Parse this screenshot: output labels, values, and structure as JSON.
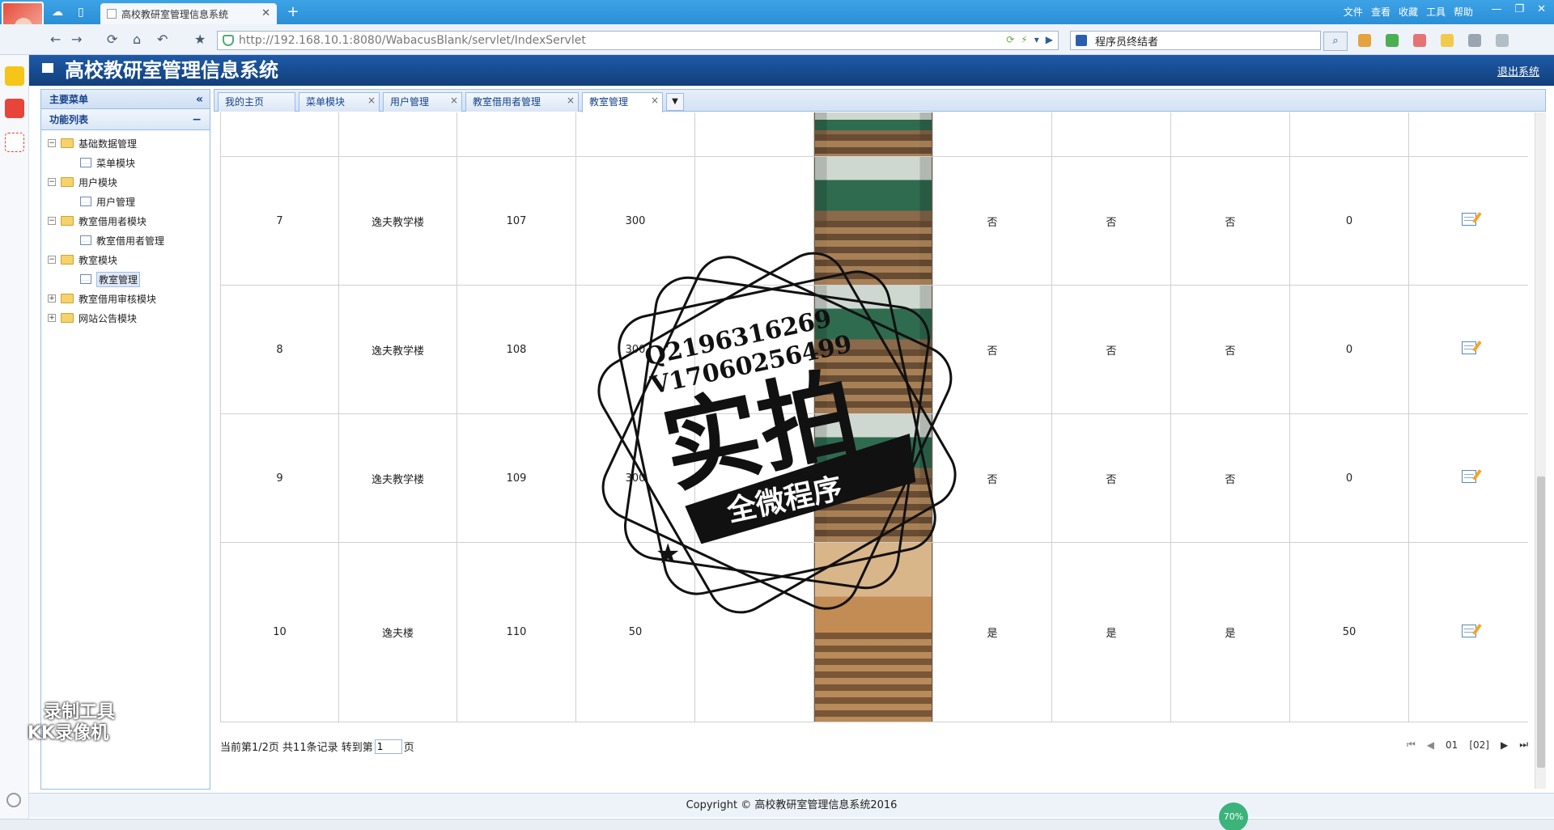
{
  "browser": {
    "tab_title": "高校教研室管理信息系统",
    "url": "http://192.168.10.1:8080/WabacusBlank/servlet/IndexServlet",
    "search_text": "程序员终结者",
    "menu": [
      "文件",
      "查看",
      "收藏",
      "工具",
      "帮助"
    ]
  },
  "app": {
    "title": "高校教研室管理信息系统",
    "logout": "退出系统",
    "footer": "Copyright © 高校教研室管理信息系统2016"
  },
  "sidebar": {
    "header": "主要菜单",
    "section": "功能列表",
    "tree": [
      {
        "label": "基础数据管理",
        "expanded": true,
        "children": [
          "菜单模块"
        ]
      },
      {
        "label": "用户模块",
        "expanded": true,
        "children": [
          "用户管理"
        ]
      },
      {
        "label": "教室借用者模块",
        "expanded": true,
        "children": [
          "教室借用者管理"
        ]
      },
      {
        "label": "教室模块",
        "expanded": true,
        "children": [
          "教室管理"
        ]
      },
      {
        "label": "教室借用审核模块",
        "expanded": false,
        "children": []
      },
      {
        "label": "网站公告模块",
        "expanded": false,
        "children": []
      }
    ]
  },
  "tabs": [
    "我的主页",
    "菜单模块",
    "用户管理",
    "教室借用者管理",
    "教室管理"
  ],
  "rows": [
    {
      "id": "",
      "building": "",
      "room": "",
      "capacity": "",
      "c5": "",
      "f1": "",
      "f2": "",
      "f3": "",
      "num": ""
    },
    {
      "id": "7",
      "building": "逸夫教学楼",
      "room": "107",
      "capacity": "300",
      "c5": "",
      "f1": "否",
      "f2": "否",
      "f3": "否",
      "num": "0"
    },
    {
      "id": "8",
      "building": "逸夫教学楼",
      "room": "108",
      "capacity": "300",
      "c5": "",
      "f1": "否",
      "f2": "否",
      "f3": "否",
      "num": "0"
    },
    {
      "id": "9",
      "building": "逸夫教学楼",
      "room": "109",
      "capacity": "300",
      "c5": "",
      "f1": "否",
      "f2": "否",
      "f3": "否",
      "num": "0"
    },
    {
      "id": "10",
      "building": "逸夫楼",
      "room": "110",
      "capacity": "50",
      "c5": "",
      "f1": "是",
      "f2": "是",
      "f3": "是",
      "num": "50"
    }
  ],
  "pager": {
    "info_prefix": "当前第1/2页 共11条记录 转到第",
    "goto_value": "1",
    "info_suffix": "页",
    "page_a": "01",
    "page_b": "[02]"
  },
  "watermark": {
    "line1": "Q2196316269",
    "line2": "V17060256499",
    "big": "实拍",
    "banner": "全微程序",
    "recorder": "录制工具",
    "recorder2": "KK录像机"
  },
  "status": {
    "speed": "70%"
  }
}
